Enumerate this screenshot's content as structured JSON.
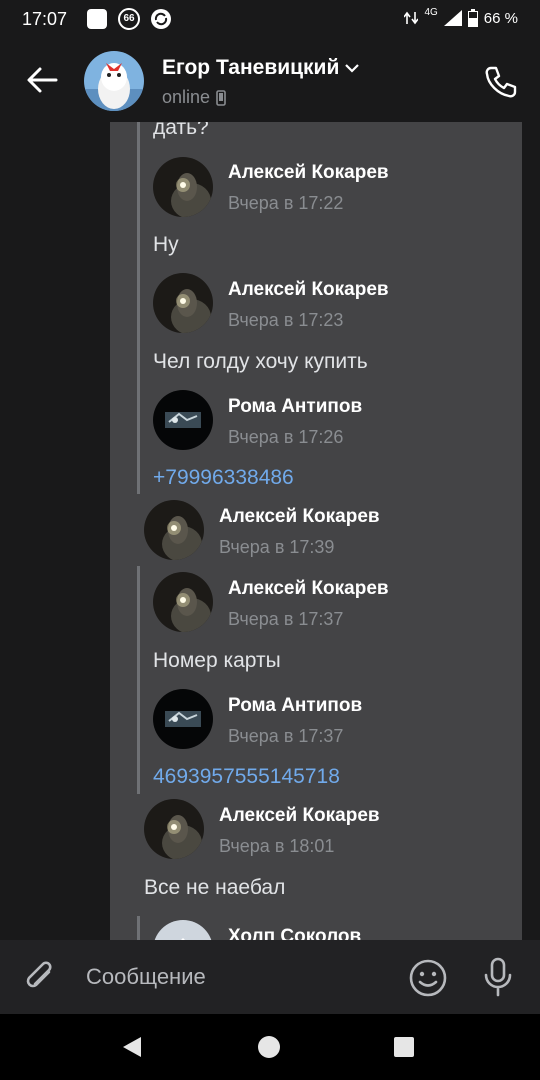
{
  "status_bar": {
    "time": "17:07",
    "notif_badge": "66",
    "network": "4G",
    "battery": "66 %"
  },
  "header": {
    "contact_name": "Егор Таневицкий",
    "contact_status": "online",
    "icons": [
      "back-arrow-icon",
      "chevron-down-icon",
      "mobile-icon",
      "phone-icon"
    ]
  },
  "messages": [
    {
      "text": "дать?"
    },
    {
      "author": "Алексей Кокарев",
      "date": "Вчера в 17:22",
      "text": "Ну"
    },
    {
      "author": "Алексей Кокарев",
      "date": "Вчера в 17:23",
      "text": "Чел голду хочу купить"
    },
    {
      "author": "Рома Антипов",
      "date": "Вчера в 17:26",
      "text": "+79996338486"
    },
    {
      "author": "Алексей Кокарев",
      "date": "Вчера в 17:39"
    },
    {
      "author": "Алексей Кокарев",
      "date": "Вчера в 17:37",
      "text": "Номер карты"
    },
    {
      "author": "Рома Антипов",
      "date": "Вчера в 17:37",
      "text": "4693957555145718"
    },
    {
      "author": "Алексей Кокарев",
      "date": "Вчера в 18:01",
      "text": "Все не наебал"
    },
    {
      "author": "Холп Соколов"
    }
  ],
  "composer": {
    "placeholder": "Сообщение",
    "icons": [
      "attach-icon",
      "emoji-icon",
      "microphone-icon"
    ]
  },
  "colors": {
    "background": "#19191a",
    "bubble": "#444446",
    "link": "#71aaeb",
    "secondary_text": "#8a8d91"
  }
}
